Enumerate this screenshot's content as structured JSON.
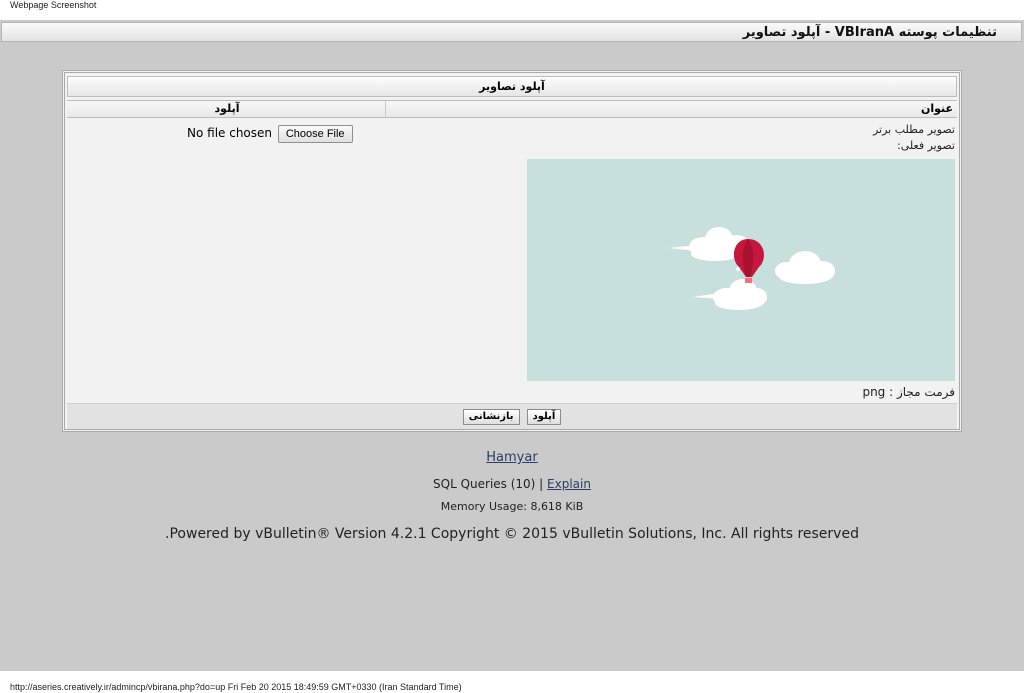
{
  "capture_label": "Webpage Screenshot",
  "titlebar": {
    "title": "تنظیمات پوسته VBIranA - آپلود تصاویر"
  },
  "panel": {
    "heading": "آپلود تصاویر",
    "columns": {
      "title": "عنوان",
      "upload": "آپلود"
    },
    "image_label": "تصویر مطلب برتر",
    "current_image_label": "تصویر فعلی:",
    "file_input": {
      "button": "Choose File",
      "status": "No file chosen"
    },
    "format_label": "فرمت مجاز :",
    "format_value": "png",
    "buttons": {
      "upload": "آپلود",
      "reset": "بازنشانی"
    },
    "preview_colors": {
      "background": "#c8e0dd",
      "balloon": "#c8173d",
      "clouds": "#ffffff"
    }
  },
  "footer": {
    "link": "Hamyar",
    "sql_prefix": "SQL Queries (10) |",
    "explain": "Explain",
    "memory": "Memory Usage: 8,618 KiB",
    "powered": ".Powered by vBulletin® Version 4.2.1 Copyright © 2015 vBulletin Solutions, Inc. All rights reserved"
  },
  "statusbar": "http://aseries.creatively.ir/admincp/vbirana.php?do=up Fri Feb 20 2015 18:49:59 GMT+0330 (Iran Standard Time)"
}
